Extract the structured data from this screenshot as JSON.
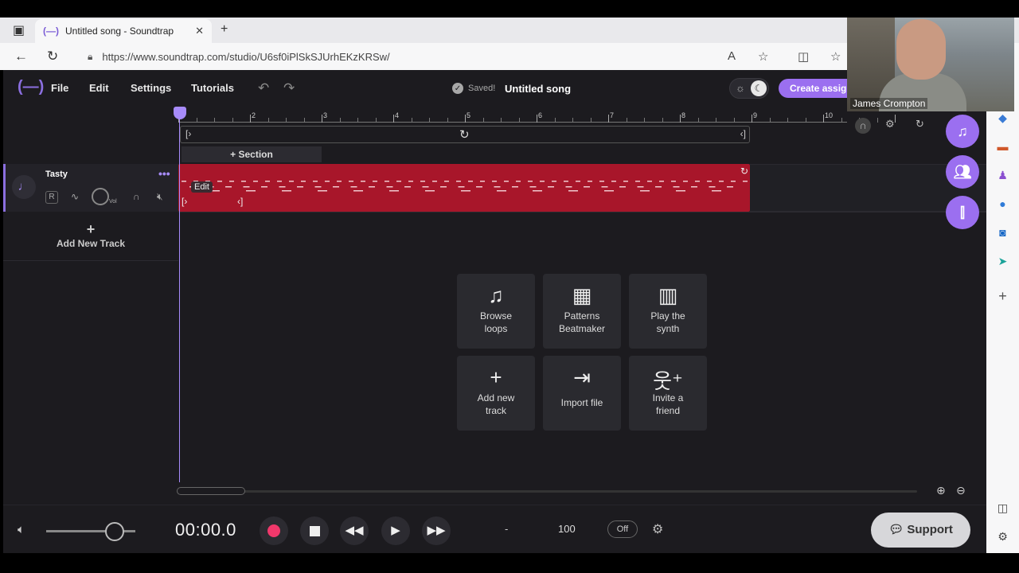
{
  "browser": {
    "tab_title": "Untitled song - Soundtrap",
    "tab_favicon": "(—)",
    "url": "https://www.soundtrap.com/studio/U6sf0iPlSkSJUrhEKzKRSw/"
  },
  "app": {
    "menu": [
      "File",
      "Edit",
      "Settings",
      "Tutorials"
    ],
    "saved_label": "Saved!",
    "song_title": "Untitled song",
    "create_button": "Create assignment",
    "accent_color": "#9b6ff0"
  },
  "timeline": {
    "bar_numbers": [
      "2",
      "3",
      "4",
      "5",
      "6",
      "7",
      "8",
      "9",
      "10"
    ],
    "section_label": "+ Section"
  },
  "track": {
    "name": "Tasty",
    "r_label": "R",
    "vol_label": "Vol",
    "region_edit": "Edit",
    "region_color": "#a8162a"
  },
  "add_track": {
    "label": "Add New Track"
  },
  "cards": [
    {
      "label1": "Browse",
      "label2": "loops",
      "icon": "music-note-icon"
    },
    {
      "label1": "Patterns",
      "label2": "Beatmaker",
      "icon": "grid-icon"
    },
    {
      "label1": "Play the",
      "label2": "synth",
      "icon": "piano-icon"
    },
    {
      "label1": "Add new",
      "label2": "track",
      "icon": "plus-icon"
    },
    {
      "label1": "Import file",
      "label2": "",
      "icon": "import-icon"
    },
    {
      "label1": "Invite a",
      "label2": "friend",
      "icon": "invite-icon"
    }
  ],
  "transport": {
    "timecode": "00:00.0",
    "key": "-",
    "bpm": "100",
    "metronome": "Off",
    "support": "Support"
  },
  "webcam": {
    "name": "James Crompton"
  }
}
